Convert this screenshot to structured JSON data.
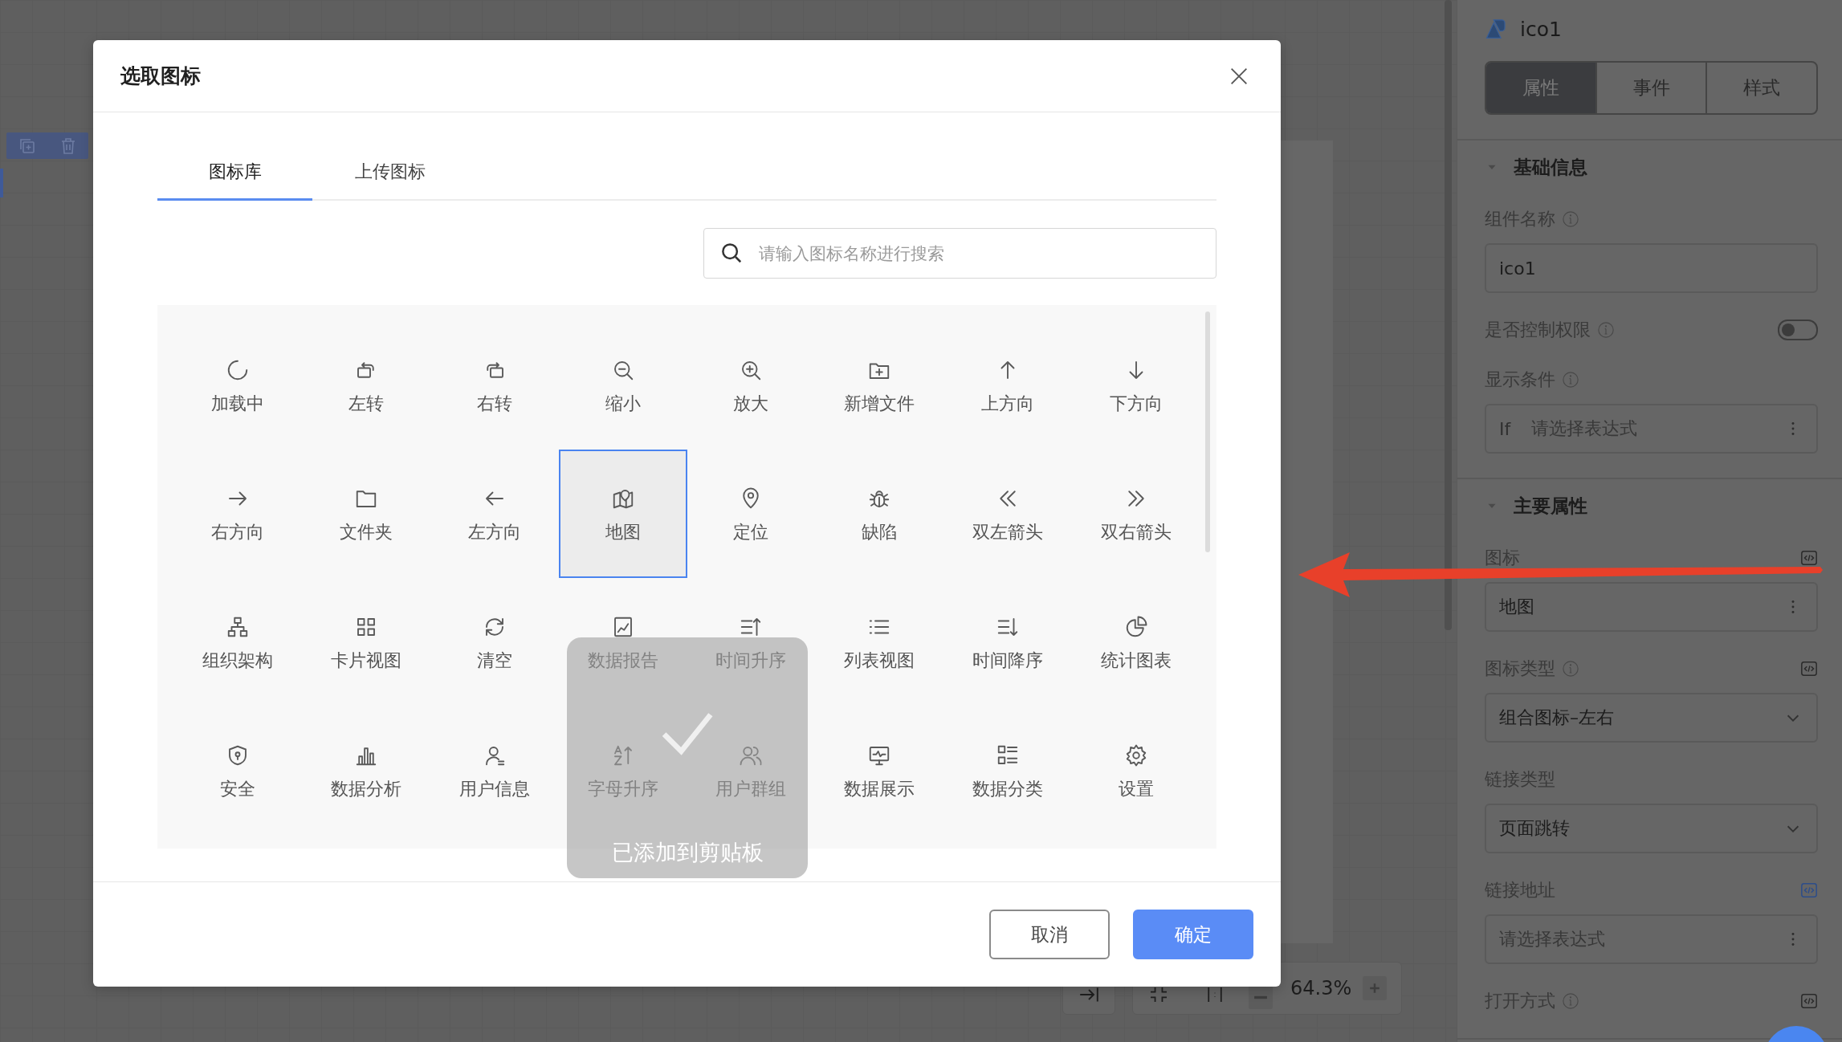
{
  "canvas": {
    "zoom_bar": {
      "zoom": "64.3%"
    }
  },
  "dialog": {
    "title": "选取图标",
    "tabs": [
      {
        "label": "图标库",
        "selected": true
      },
      {
        "label": "上传图标",
        "selected": false
      }
    ],
    "search": {
      "placeholder": "请输入图标名称进行搜索"
    },
    "icons": [
      {
        "label": "加载中",
        "selected": false
      },
      {
        "label": "左转",
        "selected": false
      },
      {
        "label": "右转",
        "selected": false
      },
      {
        "label": "缩小",
        "selected": false
      },
      {
        "label": "放大",
        "selected": false
      },
      {
        "label": "新增文件",
        "selected": false
      },
      {
        "label": "上方向",
        "selected": false
      },
      {
        "label": "下方向",
        "selected": false
      },
      {
        "label": "右方向",
        "selected": false
      },
      {
        "label": "文件夹",
        "selected": false
      },
      {
        "label": "左方向",
        "selected": false
      },
      {
        "label": "地图",
        "selected": true
      },
      {
        "label": "定位",
        "selected": false
      },
      {
        "label": "缺陷",
        "selected": false
      },
      {
        "label": "双左箭头",
        "selected": false
      },
      {
        "label": "双右箭头",
        "selected": false
      },
      {
        "label": "组织架构",
        "selected": false
      },
      {
        "label": "卡片视图",
        "selected": false
      },
      {
        "label": "清空",
        "selected": false
      },
      {
        "label": "数据报告",
        "selected": false
      },
      {
        "label": "时间升序",
        "selected": false
      },
      {
        "label": "列表视图",
        "selected": false
      },
      {
        "label": "时间降序",
        "selected": false
      },
      {
        "label": "统计图表",
        "selected": false
      },
      {
        "label": "安全",
        "selected": false
      },
      {
        "label": "数据分析",
        "selected": false
      },
      {
        "label": "用户信息",
        "selected": false
      },
      {
        "label": "字母升序",
        "selected": false
      },
      {
        "label": "用户群组",
        "selected": false
      },
      {
        "label": "数据展示",
        "selected": false
      },
      {
        "label": "数据分类",
        "selected": false
      },
      {
        "label": "设置",
        "selected": false
      }
    ],
    "toast": {
      "text": "已添加到剪贴板"
    },
    "buttons": [
      {
        "label": "取消",
        "kind": "default"
      },
      {
        "label": "确定",
        "kind": "primary"
      }
    ]
  },
  "panel": {
    "title": "ico1",
    "tabs": [
      {
        "label": "属性",
        "selected": true
      },
      {
        "label": "事件",
        "selected": false
      },
      {
        "label": "样式",
        "selected": false
      }
    ],
    "sections": [
      {
        "title": "基础信息",
        "expanded": true,
        "fields": [
          {
            "kind": "input",
            "label": "组件名称",
            "info": true,
            "value": "ico1"
          },
          {
            "kind": "toggle",
            "label": "是否控制权限",
            "info": true,
            "on": false
          },
          {
            "kind": "expression",
            "label": "显示条件",
            "info": true,
            "prefix": "If",
            "placeholder": "请选择表达式"
          }
        ]
      },
      {
        "title": "主要属性",
        "expanded": true,
        "fields": [
          {
            "kind": "picker",
            "label": "图标",
            "code_active": false,
            "value": "地图"
          },
          {
            "kind": "select",
            "label": "图标类型",
            "info": true,
            "code_active": false,
            "value": "组合图标–左右"
          },
          {
            "kind": "select",
            "label": "链接类型",
            "value": "页面跳转"
          },
          {
            "kind": "expression",
            "label": "链接地址",
            "code_active": true,
            "placeholder": "请选择表达式"
          },
          {
            "kind": "label",
            "label": "打开方式",
            "info": true,
            "code_active": false
          }
        ]
      }
    ]
  }
}
